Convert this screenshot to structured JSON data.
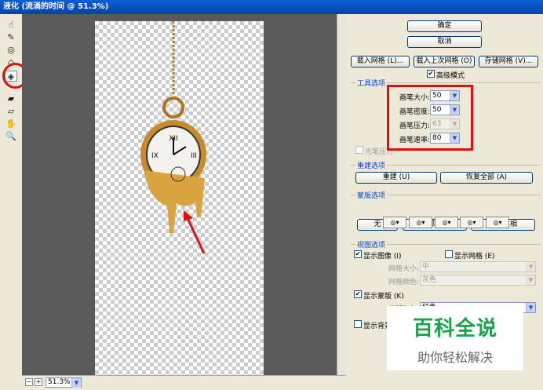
{
  "window": {
    "title": "液化 (流淌的时间 @ 51.3%)"
  },
  "toolbar": {
    "tools": [
      "forward-warp-icon",
      "reconstruct-icon",
      "twirl-icon",
      "pucker-icon",
      "bloat-icon",
      "push-left-icon",
      "mirror-icon",
      "freeze-mask-icon",
      "thaw-mask-icon",
      "hand-icon",
      "zoom-icon"
    ]
  },
  "status": {
    "zoom": "51.3%"
  },
  "buttons": {
    "ok": "确定",
    "cancel": "取消",
    "load_mesh": "载入网格 (L)...",
    "load_last_mesh": "载入上次网格 (O)",
    "save_mesh": "存储网格 (V)...",
    "advanced_mode": "高级模式"
  },
  "tool_options": {
    "title": "工具选项",
    "brush_size_label": "画笔大小:",
    "brush_size": "50",
    "brush_density_label": "画笔密度:",
    "brush_density": "50",
    "brush_pressure_label": "画笔压力:",
    "brush_pressure": "63",
    "brush_rate_label": "画笔速率:",
    "brush_rate": "80",
    "stylus_pressure": "光笔压力"
  },
  "reconstruct": {
    "title": "重建选项",
    "reconstruct_btn": "重建 (U)",
    "restore_all_btn": "恢复全部 (A)"
  },
  "mask": {
    "title": "蒙版选项",
    "none_btn": "无",
    "mask_all_btn": "全部蒙住",
    "invert_all_btn": "全部反相"
  },
  "view": {
    "title": "视图选项",
    "show_image": "显示图像 (I)",
    "show_mesh": "显示网格 (E)",
    "mesh_size_label": "网格大小:",
    "mesh_size": "中",
    "mesh_color_label": "网格颜色:",
    "mesh_color": "灰色",
    "show_mask": "显示蒙版 (K)",
    "mask_color_label": "蒙版颜色:",
    "mask_color": "红色",
    "show_backdrop": "显示背景 (P)"
  },
  "watermark": {
    "line1": "百科全说",
    "line2": "助你轻松解决"
  }
}
